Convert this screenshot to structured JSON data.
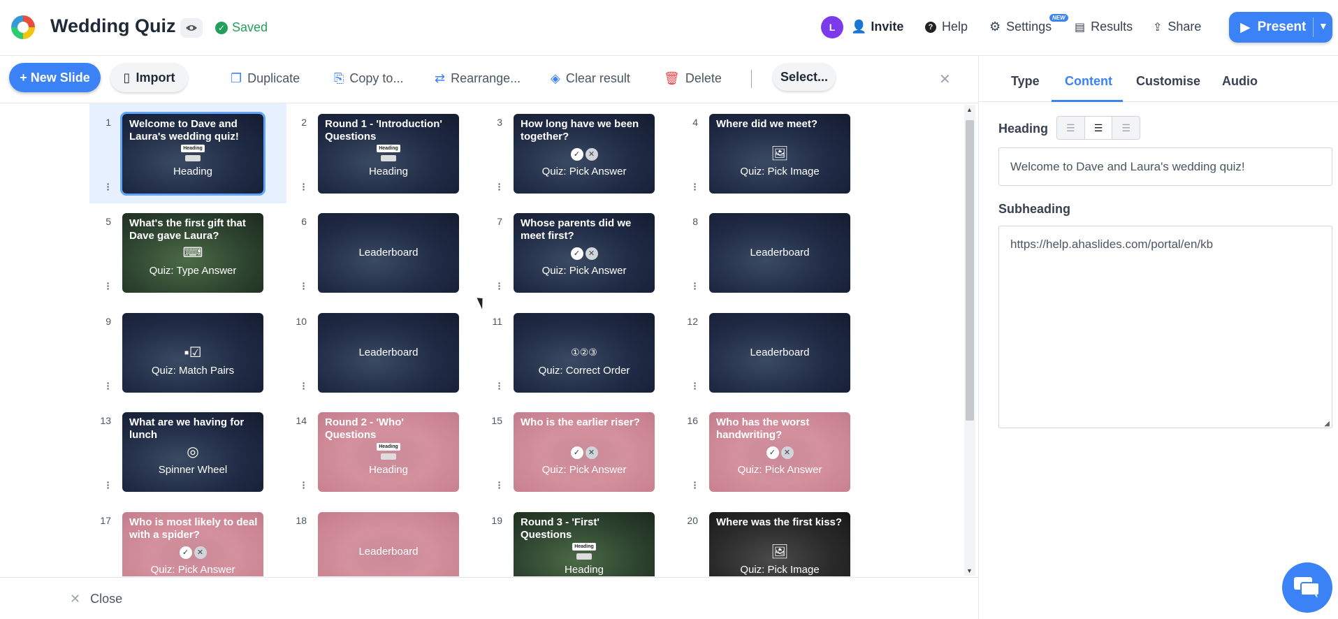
{
  "header": {
    "title": "Wedding Quiz",
    "saved": "Saved",
    "avatar_initial": "L",
    "invite": "Invite",
    "help": "Help",
    "settings": "Settings",
    "new_badge": "NEW",
    "results": "Results",
    "share": "Share",
    "present": "Present"
  },
  "toolbar": {
    "new_slide": "+ New Slide",
    "import": "Import",
    "duplicate": "Duplicate",
    "copy_to": "Copy to...",
    "rearrange": "Rearrange...",
    "clear_result": "Clear result",
    "delete": "Delete",
    "select": "Select..."
  },
  "slides": [
    {
      "n": "1",
      "title": "Welcome to Dave and Laura's wedding quiz!",
      "type": "Heading",
      "bg": "navy",
      "selected": true
    },
    {
      "n": "2",
      "title": "Round 1 - 'Introduction' Questions",
      "type": "Heading",
      "bg": "navy"
    },
    {
      "n": "3",
      "title": "How long have we been together?",
      "type": "Quiz: Pick Answer",
      "bg": "navy"
    },
    {
      "n": "4",
      "title": "Where did we meet?",
      "type": "Quiz: Pick Image",
      "bg": "navy"
    },
    {
      "n": "5",
      "title": "What's the first gift that Dave gave Laura?",
      "type": "Quiz: Type Answer",
      "bg": "green"
    },
    {
      "n": "6",
      "title": "",
      "type": "Leaderboard",
      "bg": "navy"
    },
    {
      "n": "7",
      "title": "Whose parents did we meet first?",
      "type": "Quiz: Pick Answer",
      "bg": "navy"
    },
    {
      "n": "8",
      "title": "",
      "type": "Leaderboard",
      "bg": "navy"
    },
    {
      "n": "9",
      "title": "",
      "type": "Quiz: Match Pairs",
      "bg": "navy"
    },
    {
      "n": "10",
      "title": "",
      "type": "Leaderboard",
      "bg": "navy"
    },
    {
      "n": "11",
      "title": "",
      "type": "Quiz: Correct Order",
      "bg": "navy"
    },
    {
      "n": "12",
      "title": "",
      "type": "Leaderboard",
      "bg": "navy"
    },
    {
      "n": "13",
      "title": "What are we having for lunch",
      "type": "Spinner Wheel",
      "bg": "navy"
    },
    {
      "n": "14",
      "title": "Round 2 - 'Who' Questions",
      "type": "Heading",
      "bg": "pink"
    },
    {
      "n": "15",
      "title": "Who is the earlier riser?",
      "type": "Quiz: Pick Answer",
      "bg": "pink"
    },
    {
      "n": "16",
      "title": "Who has the worst handwriting?",
      "type": "Quiz: Pick Answer",
      "bg": "pink"
    },
    {
      "n": "17",
      "title": "Who is most likely to deal with a spider?",
      "type": "Quiz: Pick Answer",
      "bg": "pink"
    },
    {
      "n": "18",
      "title": "",
      "type": "Leaderboard",
      "bg": "pink"
    },
    {
      "n": "19",
      "title": "Round 3 - 'First' Questions",
      "type": "Heading",
      "bg": "green"
    },
    {
      "n": "20",
      "title": "Where was the first kiss?",
      "type": "Quiz: Pick Image",
      "bg": "dark"
    }
  ],
  "footer": {
    "close": "Close"
  },
  "panel": {
    "tabs": [
      "Type",
      "Content",
      "Customise",
      "Audio"
    ],
    "active_tab": "Content",
    "heading_label": "Heading",
    "heading_value": "Welcome to Dave and Laura's wedding quiz!",
    "subheading_label": "Subheading",
    "subheading_value": "https://help.ahaslides.com/portal/en/kb"
  },
  "colors": {
    "accent": "#3b82f6",
    "saved": "#22a05b",
    "avatar": "#7c3aed",
    "delete": "#ef4444"
  }
}
